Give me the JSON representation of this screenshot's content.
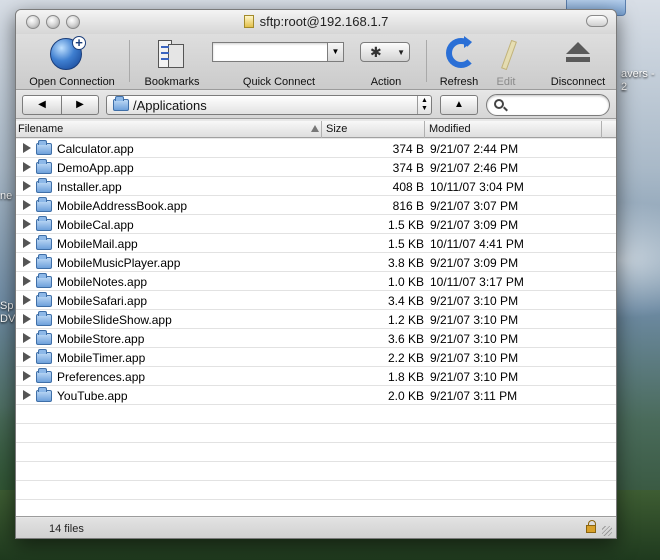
{
  "window": {
    "title": "sftp:root@192.168.1.7"
  },
  "toolbar": {
    "open_connection": "Open Connection",
    "bookmarks": "Bookmarks",
    "quick_connect": "Quick Connect",
    "action": "Action",
    "refresh": "Refresh",
    "edit": "Edit",
    "disconnect": "Disconnect"
  },
  "pathbar": {
    "back_glyph": "◀",
    "forward_glyph": "▶",
    "path": "/Applications",
    "up_glyph": "▲",
    "search_value": ""
  },
  "columns": {
    "filename": "Filename",
    "size": "Size",
    "modified": "Modified"
  },
  "files": [
    {
      "name": "Calculator.app",
      "size": "374 B",
      "modified": "9/21/07 2:44 PM"
    },
    {
      "name": "DemoApp.app",
      "size": "374 B",
      "modified": "9/21/07 2:46 PM"
    },
    {
      "name": "Installer.app",
      "size": "408 B",
      "modified": "10/11/07 3:04 PM"
    },
    {
      "name": "MobileAddressBook.app",
      "size": "816 B",
      "modified": "9/21/07 3:07 PM"
    },
    {
      "name": "MobileCal.app",
      "size": "1.5 KB",
      "modified": "9/21/07 3:09 PM"
    },
    {
      "name": "MobileMail.app",
      "size": "1.5 KB",
      "modified": "10/11/07 4:41 PM"
    },
    {
      "name": "MobileMusicPlayer.app",
      "size": "3.8 KB",
      "modified": "9/21/07 3:09 PM"
    },
    {
      "name": "MobileNotes.app",
      "size": "1.0 KB",
      "modified": "10/11/07 3:17 PM"
    },
    {
      "name": "MobileSafari.app",
      "size": "3.4 KB",
      "modified": "9/21/07 3:10 PM"
    },
    {
      "name": "MobileSlideShow.app",
      "size": "1.2 KB",
      "modified": "9/21/07 3:10 PM"
    },
    {
      "name": "MobileStore.app",
      "size": "3.6 KB",
      "modified": "9/21/07 3:10 PM"
    },
    {
      "name": "MobileTimer.app",
      "size": "2.2 KB",
      "modified": "9/21/07 3:10 PM"
    },
    {
      "name": "Preferences.app",
      "size": "1.8 KB",
      "modified": "9/21/07 3:10 PM"
    },
    {
      "name": "YouTube.app",
      "size": "2.0 KB",
      "modified": "9/21/07 3:11 PM"
    }
  ],
  "status": {
    "file_count": "14 files"
  },
  "desktop": {
    "label_right": "avers -",
    "label_right2": "2",
    "label_left1": "ne",
    "label_left2": "Sp",
    "label_left3": "DV"
  },
  "icons": {
    "open_connection": "globe-plus-icon",
    "bookmarks": "bookmarks-icon",
    "action": "gear-icon",
    "refresh": "refresh-icon",
    "edit": "pencil-icon",
    "disconnect": "eject-icon",
    "folder": "folder-icon",
    "search": "search-icon",
    "lock": "lock-icon"
  }
}
